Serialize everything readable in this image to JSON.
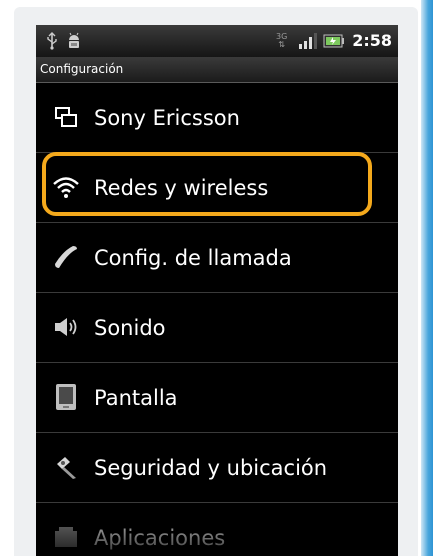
{
  "status_bar": {
    "time": "2:58",
    "network_label": "3G",
    "icons": [
      "usb-icon",
      "android-debug-icon",
      "signal-icon",
      "battery-icon"
    ]
  },
  "app": {
    "title": "Configuración"
  },
  "menu": {
    "items": [
      {
        "label": "Sony Ericsson",
        "icon": "sony-ericsson-icon"
      },
      {
        "label": "Redes y wireless",
        "icon": "wifi-icon",
        "highlighted": true
      },
      {
        "label": "Config. de llamada",
        "icon": "phone-handset-icon"
      },
      {
        "label": "Sonido",
        "icon": "speaker-icon"
      },
      {
        "label": "Pantalla",
        "icon": "display-icon"
      },
      {
        "label": "Seguridad y ubicación",
        "icon": "security-location-icon"
      },
      {
        "label": "Aplicaciones",
        "icon": "applications-icon"
      }
    ]
  },
  "colors": {
    "highlight": "#f4a91c",
    "screen_bg": "#000000",
    "text": "#ffffff",
    "accent": "#2d93d3"
  }
}
